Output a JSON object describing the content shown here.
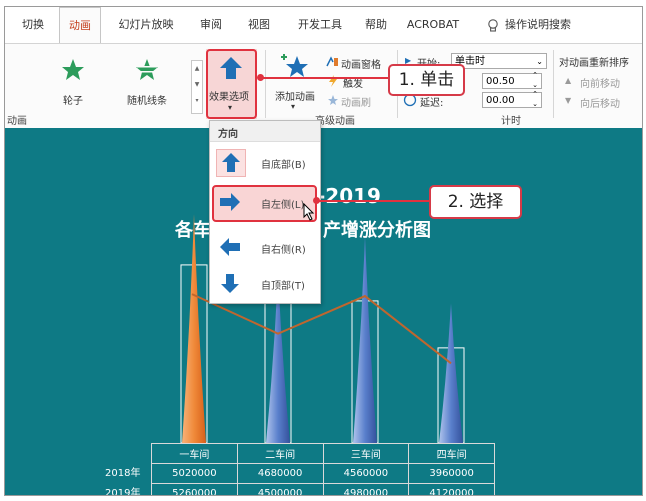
{
  "tabs": [
    "切换",
    "动画",
    "幻灯片放映",
    "审阅",
    "视图",
    "开发工具",
    "帮助",
    "ACROBAT"
  ],
  "tell_me": "操作说明搜索",
  "ribbon": {
    "effects": [
      "轮子",
      "随机线条"
    ],
    "effect_options": "效果选项",
    "add_animation": "添加动画",
    "animation_pane": "动画窗格",
    "trigger": "触发",
    "animation_painter": "动画刷",
    "start_label": "开始:",
    "start_value": "单击时",
    "duration_value": "00.50",
    "delay_label": "延迟:",
    "delay_value": "00.00",
    "reorder_title": "对动画重新排序",
    "move_earlier": "向前移动",
    "move_later": "向后移动",
    "group_animation": "动画",
    "group_advanced": "高级动画",
    "group_timing": "计时"
  },
  "dropdown": {
    "header": "方向",
    "items": [
      "自底部(B)",
      "自左侧(L)",
      "自右侧(R)",
      "自顶部(T)"
    ]
  },
  "callouts": {
    "step1": "1. 单击",
    "step2": "2. 选择"
  },
  "slide": {
    "title_line1_fragment": "-2019",
    "title_line2_left": "各车",
    "title_line2_right": "产增涨分析图"
  },
  "chart_data": {
    "type": "bar",
    "categories": [
      "一车间",
      "二车间",
      "三车间",
      "四车间"
    ],
    "series": [
      {
        "name": "2018年",
        "values": [
          5020000,
          4680000,
          4560000,
          3960000
        ]
      },
      {
        "name": "2019年",
        "values": [
          5260000,
          4500000,
          4980000,
          4120000
        ]
      }
    ]
  },
  "colors": {
    "accent": "#c43e1c",
    "slide_bg": "#0e7a85",
    "highlight": "#e0323f",
    "line": "#c0662e"
  }
}
